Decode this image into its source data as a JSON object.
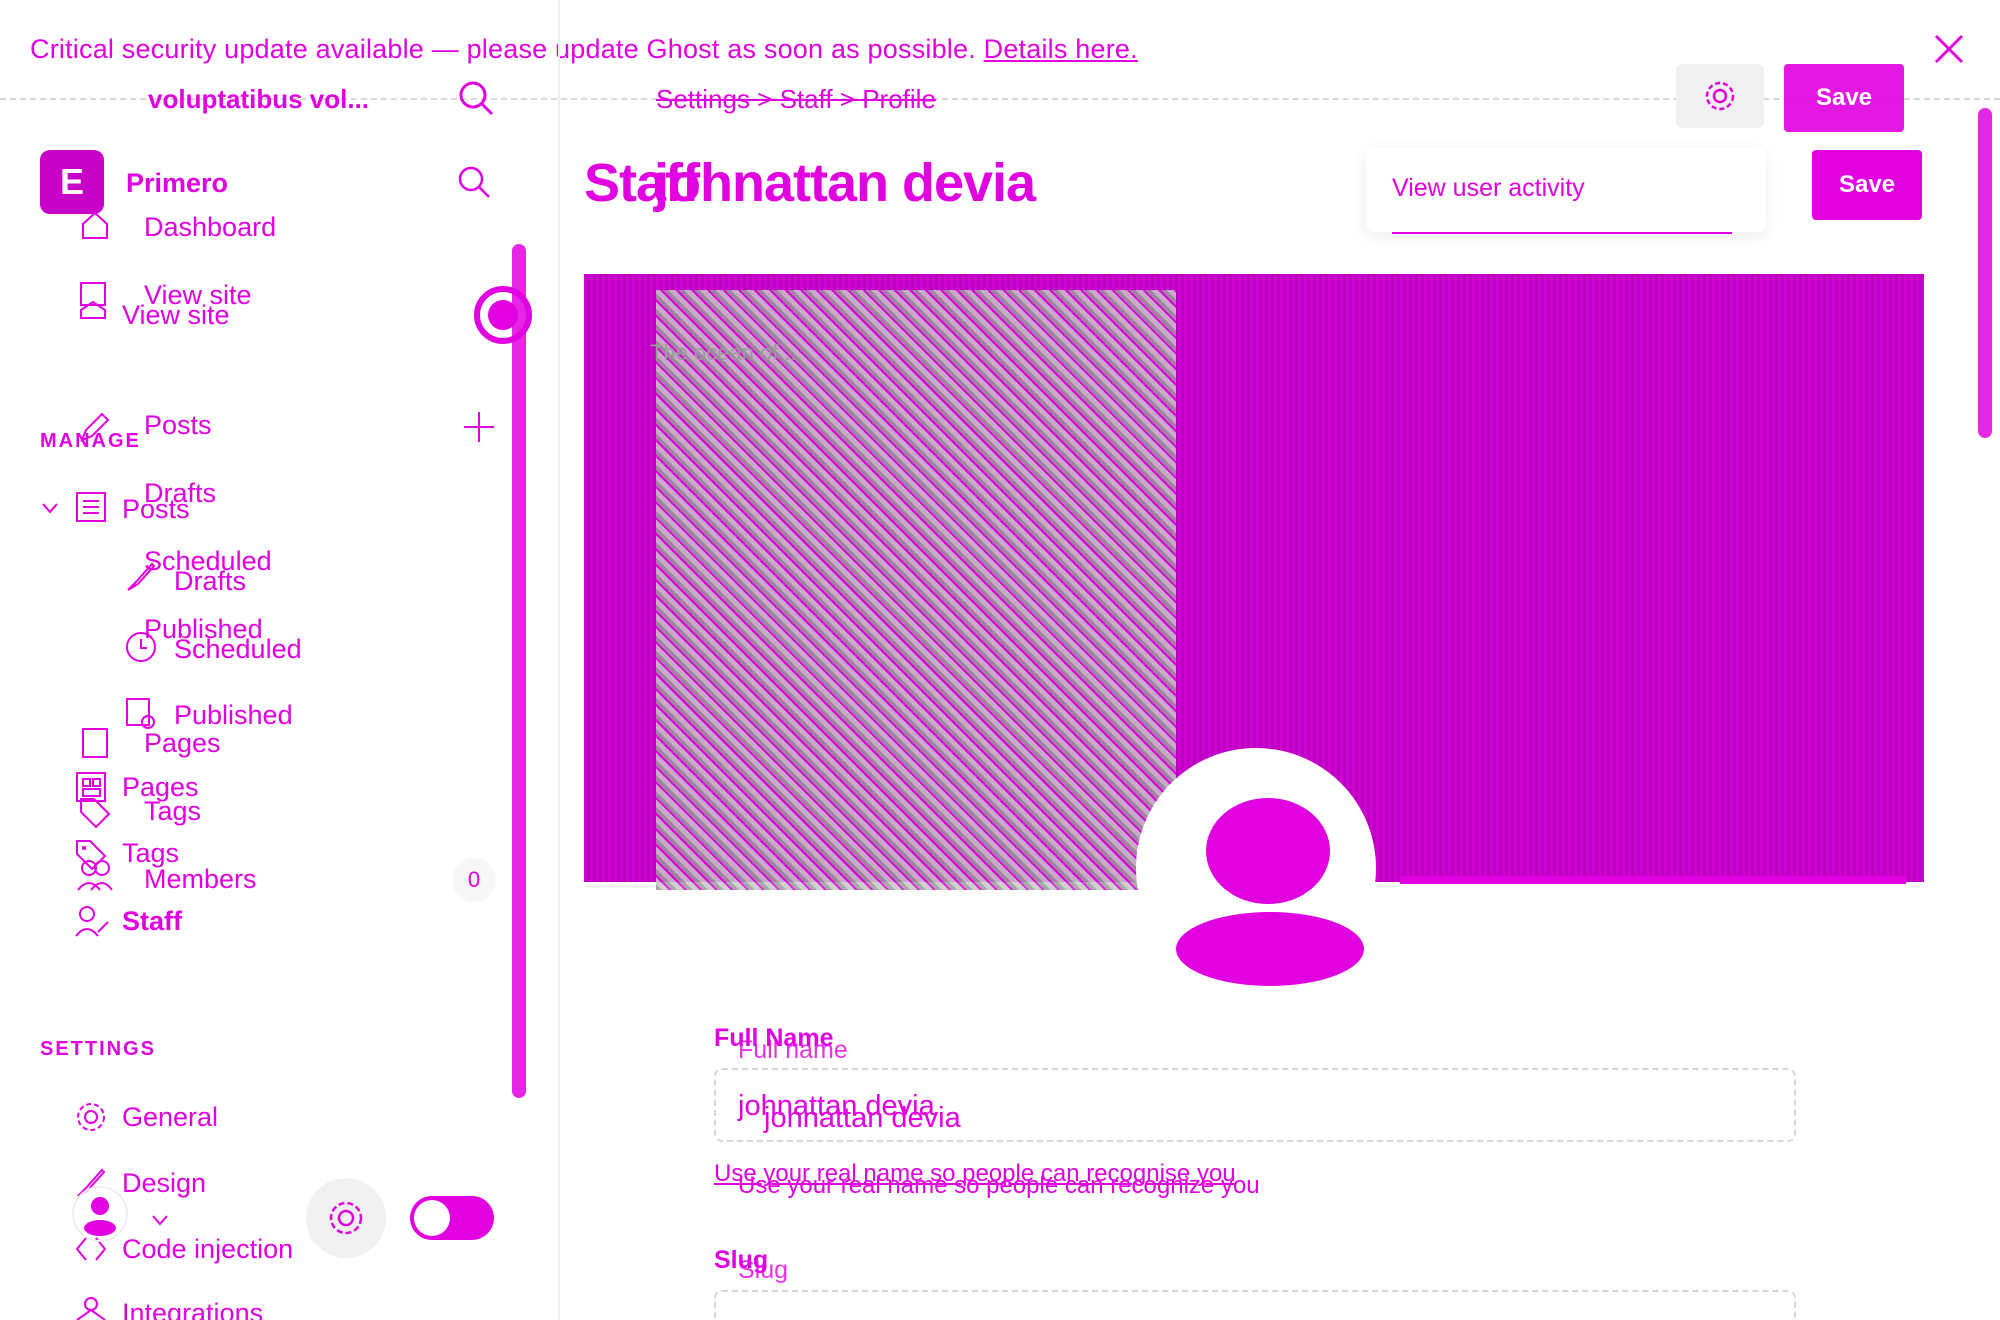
{
  "banner": {
    "text": "Critical security update available — please update Ghost as soon as possible.",
    "link": "Details here."
  },
  "header": {
    "site_name_short": "voluptatibus vol...",
    "breadcrumb": "Settings  >  Staff  >  Profile",
    "save_top": "Save",
    "save_main": "Save"
  },
  "sidebar": {
    "brand": "Primero",
    "brand_initial": "E",
    "dashboard": "Dashboard",
    "view_site": "View site",
    "view_site_back": "View site",
    "manage_label": "MANAGE",
    "posts": "Posts",
    "posts_back": "Posts",
    "drafts": "Drafts",
    "drafts_back": "Drafts",
    "scheduled": "Scheduled",
    "scheduled_back": "Scheduled",
    "published": "Published",
    "published_back": "Published",
    "pages": "Pages",
    "pages_back": "Pages",
    "tags": "Tags",
    "tags_back": "Tags",
    "members": "Members",
    "members_count": "0",
    "staff": "Staff",
    "settings_label": "SETTINGS",
    "general": "General",
    "design": "Design",
    "code_injection": "Code injection",
    "integrations": "Integrations"
  },
  "main": {
    "title": "johnattan devia",
    "title_back": "Staff",
    "dropdown_item": "View user activity",
    "full_name_label": "Full Name",
    "full_name_label_ghost": "Full name",
    "full_name_value": "johnattan devia",
    "full_name_value_ghost": "johnattan devia",
    "full_name_hint": "Use your real name so people can recognise you",
    "full_name_hint_ghost": "Use your real name so people can recognize you",
    "slug_label": "Slug",
    "slug_label_ghost": "Slug",
    "cover_caption": "The ocean of ..."
  },
  "colors": {
    "accent": "#e000e0",
    "cover": "#d000d0"
  },
  "icons": {
    "close": "close-icon",
    "search": "search-icon",
    "gear": "gear-icon",
    "home": "home-icon",
    "plus": "plus-icon",
    "pencil": "pencil-icon",
    "clock": "clock-icon",
    "page": "page-icon",
    "tag": "tag-icon",
    "members": "members-icon",
    "staff": "staff-icon",
    "brush": "brush-icon",
    "code": "code-icon",
    "integrations": "integrations-icon",
    "chevron": "chevron-down-icon"
  }
}
